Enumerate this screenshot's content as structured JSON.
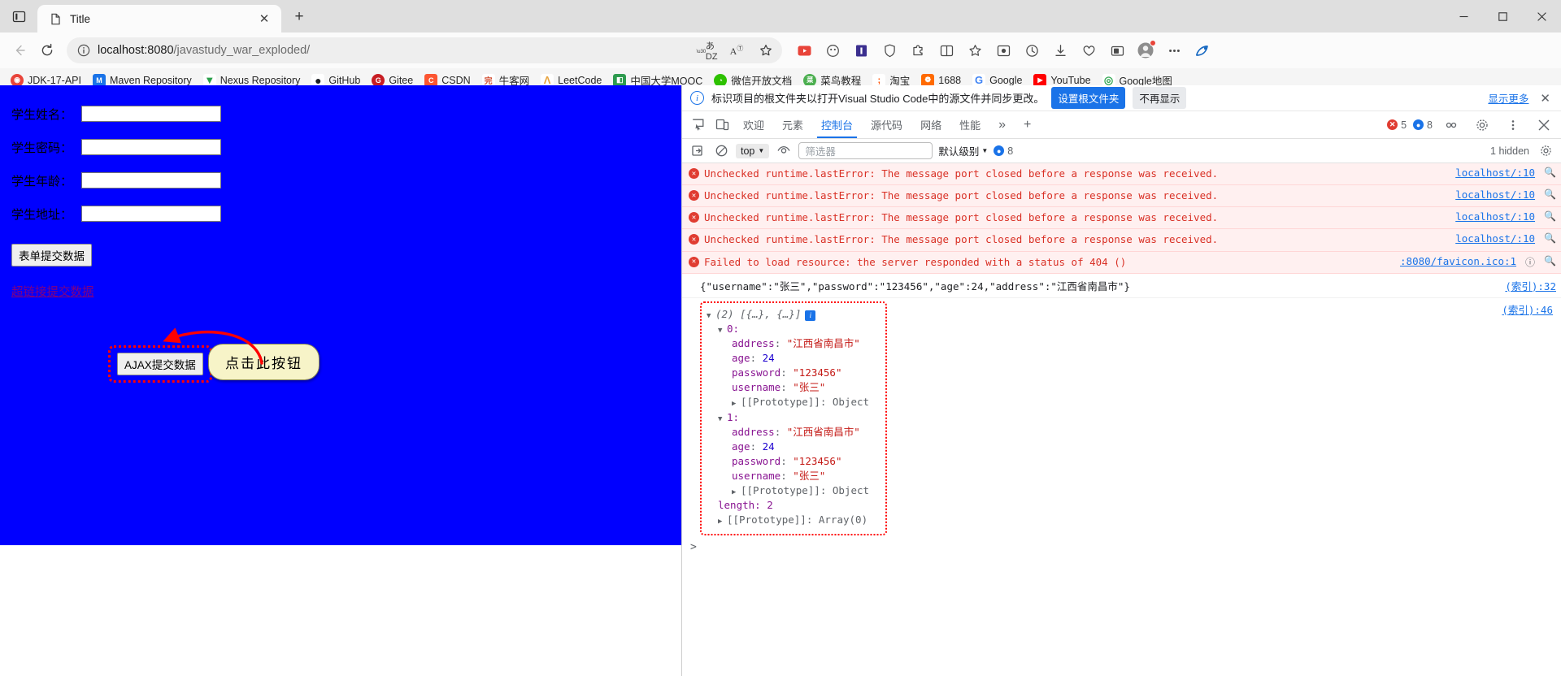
{
  "window": {
    "tab_title": "Title",
    "tab_close_label": "✕",
    "new_tab_label": "+",
    "minimize_label": "─",
    "maximize_label": "☐",
    "close_label": "✕"
  },
  "address_bar": {
    "url_host": "localhost:8080",
    "url_path": "/javastudy_war_exploded/",
    "back_icon": "back-arrow-icon",
    "reload_icon": "reload-icon",
    "info_icon": "info-circle-icon",
    "read_aloud_icon": "read-aloud-icon",
    "translate_icon": "translate-icon",
    "favorite_icon": "star-icon"
  },
  "toolbar_icons": [
    {
      "name": "media-play-icon",
      "glyph": "▶",
      "color": "#e8443a"
    },
    {
      "name": "game-icon",
      "glyph": "●",
      "color": "#555555"
    },
    {
      "name": "extension-i-icon",
      "glyph": "█",
      "color": "#8a2be2"
    },
    {
      "name": "shield-icon",
      "glyph": "◇",
      "color": "#4a4a4a"
    },
    {
      "name": "puzzle-icon",
      "glyph": "❖",
      "color": "#4a4a4a"
    },
    {
      "name": "split-screen-icon",
      "glyph": "⎕",
      "color": "#4a4a4a"
    },
    {
      "name": "collections-icon",
      "glyph": "☆",
      "color": "#4a4a4a"
    },
    {
      "name": "browser-essentials-icon",
      "glyph": "▣",
      "color": "#4a4a4a"
    },
    {
      "name": "history-icon",
      "glyph": "↺",
      "color": "#4a4a4a"
    },
    {
      "name": "downloads-icon",
      "glyph": "↓",
      "color": "#4a4a4a"
    },
    {
      "name": "performance-icon",
      "glyph": "♡",
      "color": "#4a4a4a"
    },
    {
      "name": "screenshot-icon",
      "glyph": "⌷",
      "color": "#4a4a4a"
    },
    {
      "name": "profile-avatar-icon",
      "glyph": "●",
      "color": "#5f6368"
    },
    {
      "name": "more-settings-icon",
      "glyph": "⋯",
      "color": "#4a4a4a"
    },
    {
      "name": "copilot-icon",
      "glyph": "b",
      "color": "#1668c1"
    }
  ],
  "bookmarks": [
    {
      "label": "JDK-17-API",
      "icon": "jdk-icon",
      "bg": "#e8443a",
      "ch": "◉"
    },
    {
      "label": "Maven Repository",
      "icon": "maven-icon",
      "bg": "#1a73e8",
      "ch": "M"
    },
    {
      "label": "Nexus Repository",
      "icon": "nexus-icon",
      "bg": "#ffffff",
      "ch": "▼"
    },
    {
      "label": "GitHub",
      "icon": "github-icon",
      "bg": "#ffffff",
      "ch": "●"
    },
    {
      "label": "Gitee",
      "icon": "gitee-icon",
      "bg": "#c71d23",
      "ch": "G"
    },
    {
      "label": "CSDN",
      "icon": "csdn-icon",
      "bg": "#fc5531",
      "ch": "C"
    },
    {
      "label": "牛客网",
      "icon": "nowcoder-icon",
      "bg": "#ffffff",
      "ch": "完"
    },
    {
      "label": "LeetCode",
      "icon": "leetcode-icon",
      "bg": "#ffffff",
      "ch": "Λ"
    },
    {
      "label": "中国大学MOOC",
      "icon": "mooc-icon",
      "bg": "#2e9b4f",
      "ch": "◧"
    },
    {
      "label": "微信开放文档",
      "icon": "wechat-icon",
      "bg": "#2dc100",
      "ch": "◔"
    },
    {
      "label": "菜鸟教程",
      "icon": "runoob-icon",
      "bg": "#4caf50",
      "ch": "□"
    },
    {
      "label": "淘宝",
      "icon": "taobao-icon",
      "bg": "#ff5000",
      "ch": "淘"
    },
    {
      "label": "1688",
      "icon": "alibaba-icon",
      "bg": "#ff6a00",
      "ch": "❁"
    },
    {
      "label": "Google",
      "icon": "google-icon",
      "bg": "#ffffff",
      "ch": "G"
    },
    {
      "label": "YouTube",
      "icon": "youtube-icon",
      "bg": "#ff0000",
      "ch": "▶"
    },
    {
      "label": "Google地图",
      "icon": "google-maps-icon",
      "bg": "#ffffff",
      "ch": "◎"
    }
  ],
  "page": {
    "background_color": "#0000FF",
    "fields": [
      {
        "label": "学生姓名：",
        "value": "",
        "name": "student-name"
      },
      {
        "label": "学生密码：",
        "value": "",
        "name": "student-password"
      },
      {
        "label": "学生年龄：",
        "value": "",
        "name": "student-age"
      },
      {
        "label": "学生地址：",
        "value": "",
        "name": "student-address"
      }
    ],
    "submit_button": "表单提交数据",
    "hyperlink": "超链接提交数据",
    "ajax_button": "AJAX提交数据",
    "callout": "点击此按钮",
    "annotation_color": "#FF0000",
    "callout_bg": "#F7F4C8"
  },
  "devtools": {
    "notice": {
      "text": "标识项目的根文件夹以打开Visual Studio Code中的源文件并同步更改。",
      "primary_button": "设置根文件夹",
      "secondary_button": "不再显示",
      "more_link": "显示更多",
      "close": "✕"
    },
    "tabs": [
      {
        "label": "欢迎",
        "active": false,
        "name": "tab-welcome"
      },
      {
        "label": "元素",
        "active": false,
        "name": "tab-elements"
      },
      {
        "label": "控制台",
        "active": true,
        "name": "tab-console"
      },
      {
        "label": "源代码",
        "active": false,
        "name": "tab-sources"
      },
      {
        "label": "网络",
        "active": false,
        "name": "tab-network"
      },
      {
        "label": "性能",
        "active": false,
        "name": "tab-performance"
      }
    ],
    "more_tabs": "»",
    "add_tab": "+",
    "error_count": "5",
    "message_count": "8",
    "filter_bar": {
      "context": "top",
      "filter_placeholder": "筛选器",
      "level": "默认级别",
      "info_count": "8",
      "hidden_note": "1 hidden"
    },
    "console_messages": [
      {
        "type": "error",
        "text": "Unchecked runtime.lastError: The message port closed before a response was received.",
        "source": "localhost/:10"
      },
      {
        "type": "error",
        "text": "Unchecked runtime.lastError: The message port closed before a response was received.",
        "source": "localhost/:10"
      },
      {
        "type": "error",
        "text": "Unchecked runtime.lastError: The message port closed before a response was received.",
        "source": "localhost/:10"
      },
      {
        "type": "error",
        "text": "Unchecked runtime.lastError: The message port closed before a response was received.",
        "source": "localhost/:10"
      },
      {
        "type": "error",
        "text": "Failed to load resource: the server responded with a status of 404 ()",
        "source": ":8080/favicon.ico:1"
      }
    ],
    "json_log": {
      "text": "{\"username\":\"张三\",\"password\":\"123456\",\"age\":24,\"address\":\"江西省南昌市\"}",
      "source": "(索引):32"
    },
    "object_log": {
      "source": "(索引):46",
      "header": "(2) [{…}, {…}]",
      "entries": [
        {
          "index": "0:",
          "props": [
            {
              "key": "address",
              "value": "\"江西省南昌市\"",
              "type": "string"
            },
            {
              "key": "age",
              "value": "24",
              "type": "number"
            },
            {
              "key": "password",
              "value": "\"123456\"",
              "type": "string"
            },
            {
              "key": "username",
              "value": "\"张三\"",
              "type": "string"
            }
          ],
          "proto": "[[Prototype]]: Object"
        },
        {
          "index": "1:",
          "props": [
            {
              "key": "address",
              "value": "\"江西省南昌市\"",
              "type": "string"
            },
            {
              "key": "age",
              "value": "24",
              "type": "number"
            },
            {
              "key": "password",
              "value": "\"123456\"",
              "type": "string"
            },
            {
              "key": "username",
              "value": "\"张三\"",
              "type": "string"
            }
          ],
          "proto": "[[Prototype]]: Object"
        }
      ],
      "length_line": "length: 2",
      "array_proto": "[[Prototype]]: Array(0)"
    },
    "prompt": ">"
  }
}
